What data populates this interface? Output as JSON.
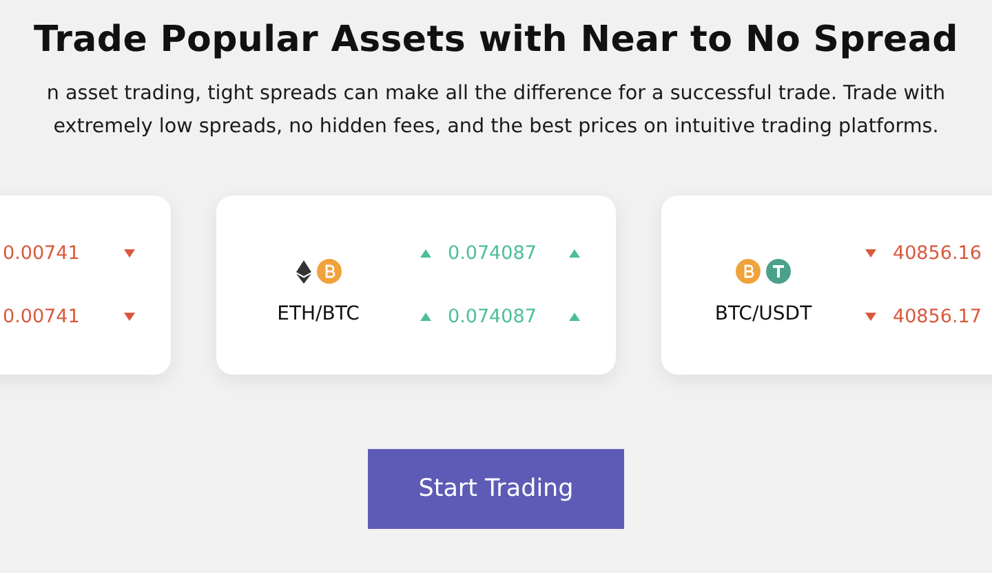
{
  "title": "Trade Popular Assets with Near to No Spread",
  "description_lines": [
    "n asset trading, tight spreads can make all the difference for a successful trade. Trade with",
    "extremely low spreads, no hidden fees, and the best prices on intuitive trading platforms."
  ],
  "cards": [
    {
      "rates": [
        {
          "up": false,
          "value": "0.00741"
        },
        {
          "up": false,
          "value": "0.00741"
        }
      ]
    },
    {
      "pair": "ETH/BTC",
      "coins": [
        {
          "kind": "eth"
        },
        {
          "kind": "btc"
        }
      ],
      "rates": [
        {
          "up": true,
          "value": "0.074087"
        },
        {
          "up": true,
          "value": "0.074087"
        }
      ]
    },
    {
      "pair": "BTC/USDT",
      "coins": [
        {
          "kind": "btc"
        },
        {
          "kind": "usdt"
        }
      ],
      "rates": [
        {
          "up": false,
          "value": "40856.16"
        },
        {
          "up": false,
          "value": "40856.17"
        }
      ]
    }
  ],
  "button": "Start Trading"
}
